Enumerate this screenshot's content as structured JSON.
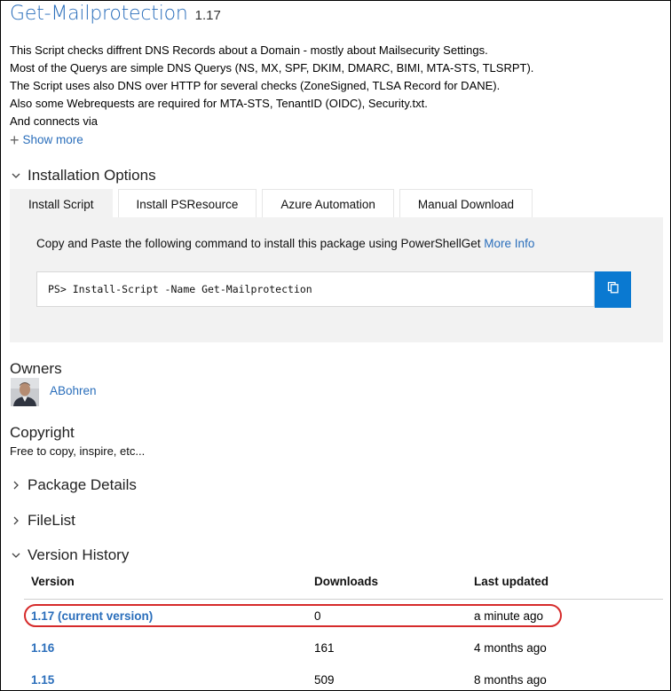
{
  "package": {
    "name": "Get-Mailprotection",
    "version": "1.17"
  },
  "description": {
    "lines": [
      "This Script checks diffrent DNS Records about a Domain - mostly about Mailsecurity Settings.",
      "Most of the Querys are simple DNS Querys (NS, MX, SPF, DKIM, DMARC, BIMI, MTA-STS, TLSRPT).",
      "The Script uses also DNS over HTTP for several checks (ZoneSigned, TLSA Record for DANE).",
      "Also some Webrequests are required for MTA-STS, TenantID (OIDC), Security.txt.",
      "And connects via"
    ],
    "show_more_label": "Show more"
  },
  "installation": {
    "heading": "Installation Options",
    "tabs": [
      {
        "label": "Install Script",
        "active": true
      },
      {
        "label": "Install PSResource",
        "active": false
      },
      {
        "label": "Azure Automation",
        "active": false
      },
      {
        "label": "Manual Download",
        "active": false
      }
    ],
    "intro_text": "Copy and Paste the following command to install this package using PowerShellGet",
    "more_info_label": "More Info",
    "command": "PS> Install-Script -Name Get-Mailprotection"
  },
  "owners": {
    "heading": "Owners",
    "items": [
      {
        "name": "ABohren"
      }
    ]
  },
  "copyright": {
    "heading": "Copyright",
    "text": "Free to copy, inspire, etc..."
  },
  "sections": {
    "package_details": "Package Details",
    "file_list": "FileList",
    "version_history": "Version History"
  },
  "version_history": {
    "columns": [
      "Version",
      "Downloads",
      "Last updated"
    ],
    "rows": [
      {
        "version": "1.17 (current version)",
        "downloads": "0",
        "updated": "a minute ago"
      },
      {
        "version": "1.16",
        "downloads": "161",
        "updated": "4 months ago"
      },
      {
        "version": "1.15",
        "downloads": "509",
        "updated": "8 months ago"
      }
    ]
  },
  "colors": {
    "link": "#2a6ebb",
    "copy_button": "#0a79d1",
    "panel_bg": "#f2f2f2",
    "highlight": "#d62b2b"
  }
}
